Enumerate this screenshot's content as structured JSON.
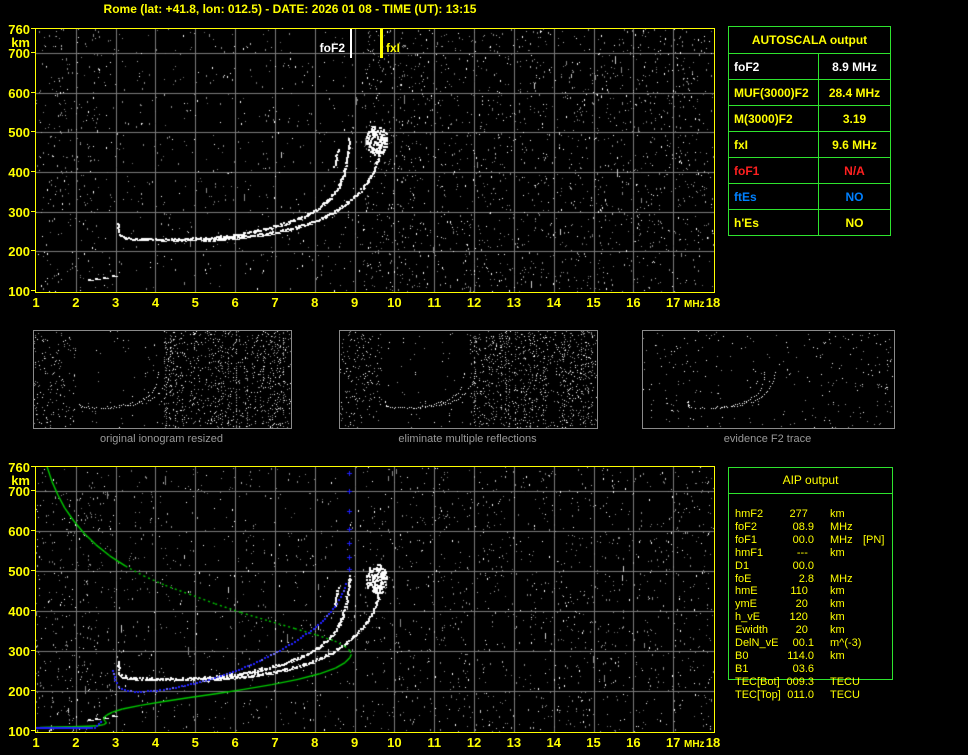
{
  "title": "Rome (lat: +41.8, lon: 012.5) - DATE: 2026 01 08 - TIME (UT): 13:15",
  "colors": {
    "accent_yellow": "#ffff00",
    "grid_gray": "#7b7b7b",
    "panel_green": "#2ee32e",
    "trace_white": "#ffffff",
    "profile_green": "#00cc00",
    "fitted_blue": "#2121ff",
    "alert_red": "#ff2020",
    "info_blue": "#0080ff",
    "caption_gray": "#9a9a9a"
  },
  "main_ionogram": {
    "x_ticks": [
      "1",
      "2",
      "3",
      "4",
      "5",
      "6",
      "7",
      "8",
      "9",
      "10",
      "11",
      "12",
      "13",
      "14",
      "15",
      "16",
      "17",
      "18"
    ],
    "x_unit": "MHz",
    "y_ticks": [
      "760",
      "700",
      "600",
      "500",
      "400",
      "300",
      "200",
      "100"
    ],
    "y_unit": "km",
    "markers": [
      {
        "label": "foF2",
        "freq_mhz": 8.9,
        "color": "#ffffff"
      },
      {
        "label": "fxI",
        "freq_mhz": 9.65,
        "color": "#ffff00"
      }
    ]
  },
  "autoscala": {
    "header": "AUTOSCALA output",
    "rows": [
      {
        "param": "foF2",
        "value": "8.9 MHz",
        "color": "#ffffff"
      },
      {
        "param": "MUF(3000)F2",
        "value": "28.4 MHz",
        "color": "#ffff00"
      },
      {
        "param": "M(3000)F2",
        "value": "3.19",
        "color": "#ffff00"
      },
      {
        "param": "fxI",
        "value": "9.6 MHz",
        "color": "#ffff00"
      },
      {
        "param": "foF1",
        "value": "N/A",
        "color": "#ff2020"
      },
      {
        "param": "ftEs",
        "value": "NO",
        "color": "#0080ff"
      },
      {
        "param": "h'Es",
        "value": "NO",
        "color": "#ffff00"
      }
    ]
  },
  "thumbnails": [
    {
      "caption": "original ionogram resized"
    },
    {
      "caption": "eliminate multiple reflections"
    },
    {
      "caption": "evidence F2 trace"
    }
  ],
  "aip": {
    "header": "AIP output",
    "rows": [
      {
        "param": "hmF2",
        "value": "277",
        "unit": "km",
        "note": ""
      },
      {
        "param": "foF2",
        "value": "08.9",
        "unit": "MHz",
        "note": ""
      },
      {
        "param": "foF1",
        "value": "00.0",
        "unit": "MHz",
        "note": "[PN]"
      },
      {
        "param": "hmF1",
        "value": "---",
        "unit": "km",
        "note": ""
      },
      {
        "param": "D1",
        "value": "00.0",
        "unit": "",
        "note": ""
      },
      {
        "param": "foE",
        "value": "2.8",
        "unit": "MHz",
        "note": ""
      },
      {
        "param": "hmE",
        "value": "110",
        "unit": "km",
        "note": ""
      },
      {
        "param": "ymE",
        "value": "20",
        "unit": "km",
        "note": ""
      },
      {
        "param": "h_vE",
        "value": "120",
        "unit": "km",
        "note": ""
      },
      {
        "param": "Ewidth",
        "value": "20",
        "unit": "km",
        "note": ""
      },
      {
        "param": "DelN_vE",
        "value": "00.1",
        "unit": "m^(-3)",
        "note": ""
      },
      {
        "param": "B0",
        "value": "114.0",
        "unit": "km",
        "note": ""
      },
      {
        "param": "B1",
        "value": "03.6",
        "unit": "",
        "note": ""
      },
      {
        "param": "TEC[Bot]",
        "value": "009.3",
        "unit": "TECU",
        "note": ""
      },
      {
        "param": "TEC[Top]",
        "value": "011.0",
        "unit": "TECU",
        "note": ""
      }
    ]
  },
  "chart_data": {
    "type": "scatter",
    "x_range_mhz": [
      1,
      18
    ],
    "y_range_km": [
      100,
      760
    ],
    "grid": "on",
    "o_trace_mhz_km": [
      [
        3.06,
        272
      ],
      [
        3.07,
        256
      ],
      [
        3.09,
        244
      ],
      [
        3.18,
        237
      ],
      [
        3.4,
        233
      ],
      [
        3.8,
        231
      ],
      [
        4.3,
        230
      ],
      [
        4.8,
        231
      ],
      [
        5.3,
        234
      ],
      [
        5.8,
        239
      ],
      [
        6.3,
        247
      ],
      [
        6.8,
        258
      ],
      [
        7.3,
        272
      ],
      [
        7.75,
        290
      ],
      [
        8.1,
        310
      ],
      [
        8.4,
        335
      ],
      [
        8.6,
        362
      ],
      [
        8.72,
        392
      ],
      [
        8.8,
        425
      ],
      [
        8.85,
        458
      ],
      [
        8.87,
        490
      ]
    ],
    "x_trace_mhz_km": [
      [
        5.2,
        229
      ],
      [
        5.8,
        233
      ],
      [
        6.4,
        239
      ],
      [
        7.0,
        248
      ],
      [
        7.5,
        260
      ],
      [
        8.0,
        276
      ],
      [
        8.45,
        297
      ],
      [
        8.85,
        325
      ],
      [
        9.2,
        358
      ],
      [
        9.45,
        395
      ],
      [
        9.58,
        432
      ],
      [
        9.65,
        468
      ],
      [
        9.67,
        495
      ]
    ],
    "cusp_mhz_km": [
      [
        8.5,
        415
      ],
      [
        8.56,
        445
      ],
      [
        8.6,
        462
      ]
    ],
    "spread_blob": {
      "center_mhz": 9.55,
      "center_km": 480,
      "rx_mhz": 0.17,
      "ry_km": 38
    },
    "es_fragment_mhz_km": [
      [
        2.32,
        128
      ],
      [
        2.5,
        132
      ],
      [
        2.7,
        135
      ],
      [
        2.92,
        139
      ]
    ],
    "profile_green_mhz_km": [
      [
        1.28,
        760
      ],
      [
        1.4,
        724
      ],
      [
        1.55,
        690
      ],
      [
        1.72,
        658
      ],
      [
        1.95,
        625
      ],
      [
        2.2,
        595
      ],
      [
        2.5,
        566
      ],
      [
        2.85,
        538
      ],
      [
        3.25,
        512
      ],
      [
        3.7,
        488
      ],
      [
        4.25,
        464
      ],
      [
        4.85,
        442
      ],
      [
        5.5,
        418
      ],
      [
        6.15,
        396
      ],
      [
        6.85,
        375
      ],
      [
        7.5,
        356
      ],
      [
        8.05,
        340
      ],
      [
        8.5,
        325
      ],
      [
        8.75,
        312
      ],
      [
        8.88,
        301
      ],
      [
        8.92,
        292
      ],
      [
        8.88,
        283
      ],
      [
        8.76,
        271
      ],
      [
        8.52,
        257
      ],
      [
        8.12,
        243
      ],
      [
        7.58,
        229
      ],
      [
        6.92,
        216
      ],
      [
        6.22,
        204
      ],
      [
        5.52,
        193
      ],
      [
        4.82,
        183
      ],
      [
        4.17,
        173
      ],
      [
        3.62,
        164
      ],
      [
        3.17,
        155
      ],
      [
        2.92,
        147
      ],
      [
        2.78,
        140
      ],
      [
        2.71,
        134
      ],
      [
        2.7,
        129
      ],
      [
        2.74,
        124
      ],
      [
        2.77,
        120
      ],
      [
        2.7,
        116
      ],
      [
        2.55,
        113
      ],
      [
        2.28,
        112
      ],
      [
        1.9,
        111
      ],
      [
        1.5,
        110
      ],
      [
        1.1,
        109
      ]
    ],
    "profile_dashed_segment": [
      8,
      19
    ],
    "fitted_blue_mhz_km": [
      [
        2.92,
        252
      ],
      [
        2.98,
        230
      ],
      [
        3.06,
        212
      ],
      [
        3.22,
        203
      ],
      [
        3.55,
        199
      ],
      [
        3.95,
        201
      ],
      [
        4.35,
        207
      ],
      [
        4.8,
        216
      ],
      [
        5.25,
        227
      ],
      [
        5.7,
        241
      ],
      [
        6.15,
        257
      ],
      [
        6.6,
        276
      ],
      [
        7.05,
        298
      ],
      [
        7.5,
        324
      ],
      [
        7.9,
        352
      ],
      [
        8.25,
        382
      ],
      [
        8.5,
        412
      ],
      [
        8.68,
        444
      ],
      [
        8.8,
        476
      ]
    ],
    "fof2_asymptote_mhz": 8.86,
    "asymptote_plus_km": [
      505,
      535,
      568,
      605,
      648,
      698,
      745
    ],
    "e_layer_blue": {
      "height_km": 108,
      "from_mhz": 1.02,
      "to_mhz": 2.42,
      "tail_mhz_km": [
        [
          2.46,
          110
        ],
        [
          2.52,
          114
        ],
        [
          2.58,
          119
        ],
        [
          2.62,
          125
        ]
      ]
    }
  }
}
